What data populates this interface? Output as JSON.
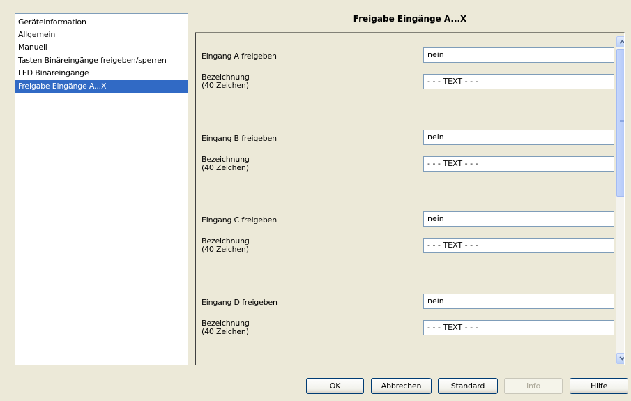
{
  "nav": {
    "items": [
      {
        "label": "Geräteinformation"
      },
      {
        "label": "Allgemein"
      },
      {
        "label": "Manuell"
      },
      {
        "label": "Tasten Binäreingänge freigeben/sperren"
      },
      {
        "label": "LED Binäreingänge"
      },
      {
        "label": "Freigabe Eingänge A...X",
        "selected": true
      }
    ]
  },
  "panel": {
    "title": "Freigabe Eingänge A...X",
    "groups": [
      {
        "enable_label": "Eingang A freigeben",
        "enable_value": "nein",
        "name_label_1": "Bezeichnung",
        "name_label_2": "(40 Zeichen)",
        "name_value": "- - - TEXT - - -"
      },
      {
        "enable_label": "Eingang B freigeben",
        "enable_value": "nein",
        "name_label_1": "Bezeichnung",
        "name_label_2": "(40 Zeichen)",
        "name_value": "- - - TEXT - - -"
      },
      {
        "enable_label": "Eingang C freigeben",
        "enable_value": "nein",
        "name_label_1": "Bezeichnung",
        "name_label_2": "(40 Zeichen)",
        "name_value": "- - - TEXT - - -"
      },
      {
        "enable_label": "Eingang D freigeben",
        "enable_value": "nein",
        "name_label_1": "Bezeichnung",
        "name_label_2": "(40 Zeichen)",
        "name_value": "- - - TEXT - - -"
      }
    ]
  },
  "buttons": {
    "ok": "OK",
    "cancel": "Abbrechen",
    "default": "Standard",
    "info": "Info",
    "help": "Hilfe"
  },
  "colors": {
    "selection": "#316ac5",
    "dialog_bg": "#ece9d8"
  },
  "icons": {
    "scroll_up": "chevron-up-icon",
    "scroll_down": "chevron-down-icon",
    "scroll_grip": "grip-icon"
  }
}
